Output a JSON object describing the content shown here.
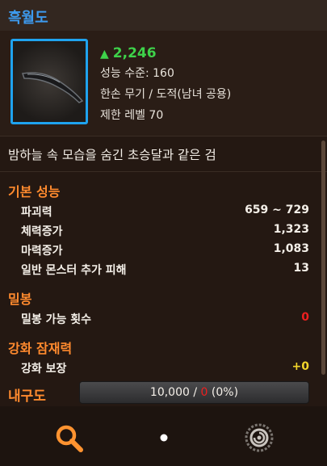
{
  "window": {
    "title": "흑월도"
  },
  "item": {
    "power": "2,246",
    "level_req": "성능 수준: 160",
    "category": "한손 무기 / 도적(남녀 공용)",
    "limit_level": "제한 레벨 70",
    "description": "밤하늘 속 모습을 숨긴 초승달과 같은 검"
  },
  "basic_stats": {
    "heading": "기본 성능",
    "rows": [
      {
        "label": "파괴력",
        "value": "659 ~ 729"
      },
      {
        "label": "체력증가",
        "value": "1,323"
      },
      {
        "label": "마력증가",
        "value": "1,083"
      },
      {
        "label": "일반 몬스터 추가 피해",
        "value": "13"
      }
    ]
  },
  "seal": {
    "heading": "밀봉",
    "label": "밀봉 가능 횟수",
    "value": "0"
  },
  "enhance": {
    "heading": "강화 잠재력",
    "label": "강화 보장",
    "value": "+0"
  },
  "durability": {
    "label": "내구도",
    "current": "10,000",
    "slash": "/",
    "max": "0",
    "percent": "(0%)"
  },
  "colors": {
    "accent_blue": "#3d9bef",
    "power_green": "#3ed24a",
    "section_orange": "#ff8a2e",
    "warn_red": "#ee1f1f",
    "bonus_yellow": "#f3d62b"
  },
  "icons": [
    "search-icon",
    "page-dot-icon",
    "spiral-icon",
    "triangle-up-icon"
  ]
}
